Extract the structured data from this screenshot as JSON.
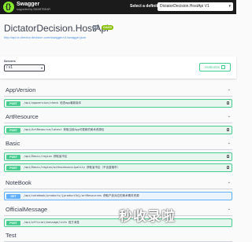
{
  "topbar": {
    "logo_name": "Swagger",
    "logo_sub": "supported by SMARTBEAR",
    "definition_label": "Select a definition",
    "definition_value": "DictatorDecision.HostApi V1"
  },
  "info": {
    "title": "DictatorDecision.HostApi",
    "version": "v1",
    "oas": "OAS3",
    "url": "http://api.tx.director.decision.com/swagger/v1/swagger.json"
  },
  "servers": {
    "label": "Servers",
    "selected": "/ v1",
    "authorize_label": "Authorize"
  },
  "sections": [
    {
      "name": "AppVersion",
      "ops": [
        {
          "method": "POST",
          "path": "/api/appversion/check",
          "desc": "检查app最新版本"
        }
      ]
    },
    {
      "name": "ArtResource",
      "ops": [
        {
          "method": "POST",
          "path": "/api/ArtResource/latest",
          "desc": "获取当前App可更新的美术资源包"
        }
      ]
    },
    {
      "name": "Basic",
      "ops": [
        {
          "method": "POST",
          "path": "/api/Basic/region",
          "desc": "获取省市区"
        },
        {
          "method": "POST",
          "path": "/api/Basic/region/withoutmunicipality",
          "desc": "获取省市区（不含直辖市）"
        }
      ]
    },
    {
      "name": "NoteBook",
      "ops": [
        {
          "method": "GET",
          "path": "/api/notebook/products/{productId}/artResources",
          "desc": "获取产品对应的美术素材资源"
        }
      ]
    },
    {
      "name": "OfficialMessage",
      "ops": [
        {
          "method": "POST",
          "path": "/api/official/message/info",
          "desc": "官方消息"
        }
      ]
    },
    {
      "name": "Test",
      "ops": []
    }
  ],
  "watermark": "秒收录啦"
}
